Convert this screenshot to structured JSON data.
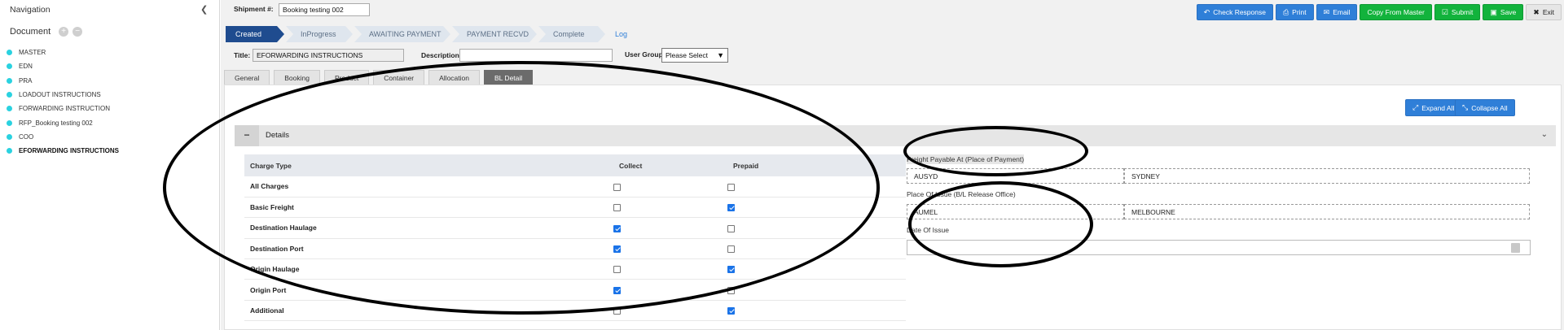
{
  "sidebar": {
    "title": "Navigation",
    "document_label": "Document",
    "items": [
      {
        "label": "MASTER"
      },
      {
        "label": "EDN"
      },
      {
        "label": "PRA"
      },
      {
        "label": "LOADOUT INSTRUCTIONS"
      },
      {
        "label": "FORWARDING INSTRUCTION"
      },
      {
        "label": "RFP_Booking testing 002"
      },
      {
        "label": "COO"
      },
      {
        "label": "EFORWARDING INSTRUCTIONS"
      }
    ]
  },
  "header": {
    "shipment_label": "Shipment #:",
    "shipment_value": "Booking testing 002"
  },
  "toolbar": {
    "check_response": "Check Response",
    "print": "Print",
    "email": "Email",
    "copy_from_master": "Copy From Master",
    "submit": "Submit",
    "save": "Save",
    "exit": "Exit"
  },
  "status_steps": [
    "Created",
    "InProgress",
    "AWAITING PAYMENT",
    "PAYMENT RECVD",
    "Complete"
  ],
  "log_link": "Log",
  "form": {
    "title_label": "Title:",
    "title_value": "EFORWARDING INSTRUCTIONS",
    "description_label": "Description:",
    "description_value": "",
    "user_group_label": "User Group:",
    "user_group_value": "Please Select"
  },
  "tabs": [
    "General",
    "Booking",
    "Product",
    "Container",
    "Allocation",
    "BL Detail"
  ],
  "active_tab": "BL Detail",
  "actions": {
    "expand_all": "Expand All",
    "collapse_all": "Collapse All"
  },
  "details": {
    "section_title": "Details",
    "columns": [
      "Charge Type",
      "Collect",
      "Prepaid"
    ],
    "rows": [
      {
        "charge": "All Charges",
        "collect": false,
        "prepaid": false
      },
      {
        "charge": "Basic Freight",
        "collect": false,
        "prepaid": true
      },
      {
        "charge": "Destination Haulage",
        "collect": true,
        "prepaid": false
      },
      {
        "charge": "Destination Port",
        "collect": true,
        "prepaid": false
      },
      {
        "charge": "Origin Haulage",
        "collect": false,
        "prepaid": true
      },
      {
        "charge": "Origin Port",
        "collect": true,
        "prepaid": false
      },
      {
        "charge": "Additional",
        "collect": false,
        "prepaid": true
      }
    ],
    "freight_payable_label": "Freight Payable At (Place of Payment)",
    "freight_payable_code": "AUSYD",
    "freight_payable_city": "SYDNEY",
    "place_of_issue_label": "Place Of Issue (B/L Release Office)",
    "place_of_issue_code": "AUMEL",
    "place_of_issue_city": "MELBOURNE",
    "date_of_issue_label": "Date Of Issue",
    "date_of_issue_value": ""
  }
}
